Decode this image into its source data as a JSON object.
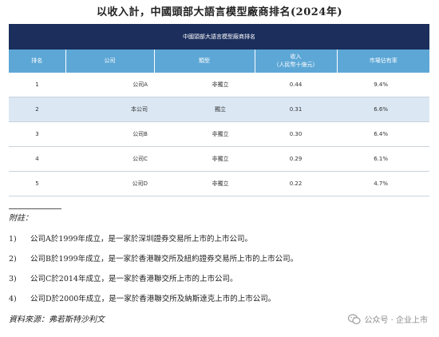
{
  "title": "以收入計，中國頭部大語言模型廠商排名(2024年)",
  "table": {
    "banner": "中國頭部大語言模型廠商排名",
    "headers": {
      "rank": "排名",
      "company": "公司",
      "category": "類型",
      "revenue_l1": "收入",
      "revenue_l2": "（人民幣十億元）",
      "share": "市場佔有率"
    },
    "rows": [
      {
        "rank": "1",
        "company": "公司A",
        "category": "非獨立",
        "revenue": "0.44",
        "share": "9.4%"
      },
      {
        "rank": "2",
        "company": "本公司",
        "category": "獨立",
        "revenue": "0.31",
        "share": "6.6%"
      },
      {
        "rank": "3",
        "company": "公司B",
        "category": "非獨立",
        "revenue": "0.30",
        "share": "6.4%"
      },
      {
        "rank": "4",
        "company": "公司C",
        "category": "非獨立",
        "revenue": "0.29",
        "share": "6.1%"
      },
      {
        "rank": "5",
        "company": "公司D",
        "category": "非獨立",
        "revenue": "0.22",
        "share": "4.7%"
      }
    ]
  },
  "notes": {
    "label": "附註：",
    "items": [
      {
        "num": "1)",
        "text": "公司A於1999年成立，是一家於深圳證券交易所上市的上市公司。"
      },
      {
        "num": "2)",
        "text": "公司B於1999年成立，是一家於香港聯交所及紐約證券交易所上市的上市公司。"
      },
      {
        "num": "3)",
        "text": "公司C於2014年成立，是一家於香港聯交所上市的上市公司。"
      },
      {
        "num": "4)",
        "text": "公司D於2000年成立，是一家於香港聯交所及納斯達克上市的上市公司。"
      }
    ]
  },
  "source": "資料來源：弗若斯特沙利文",
  "watermark": "公众号 · 企业上市",
  "colors": {
    "banner": "#1b2e5c",
    "header": "#5da7d6",
    "highlight_row": "#dbe8f4"
  }
}
